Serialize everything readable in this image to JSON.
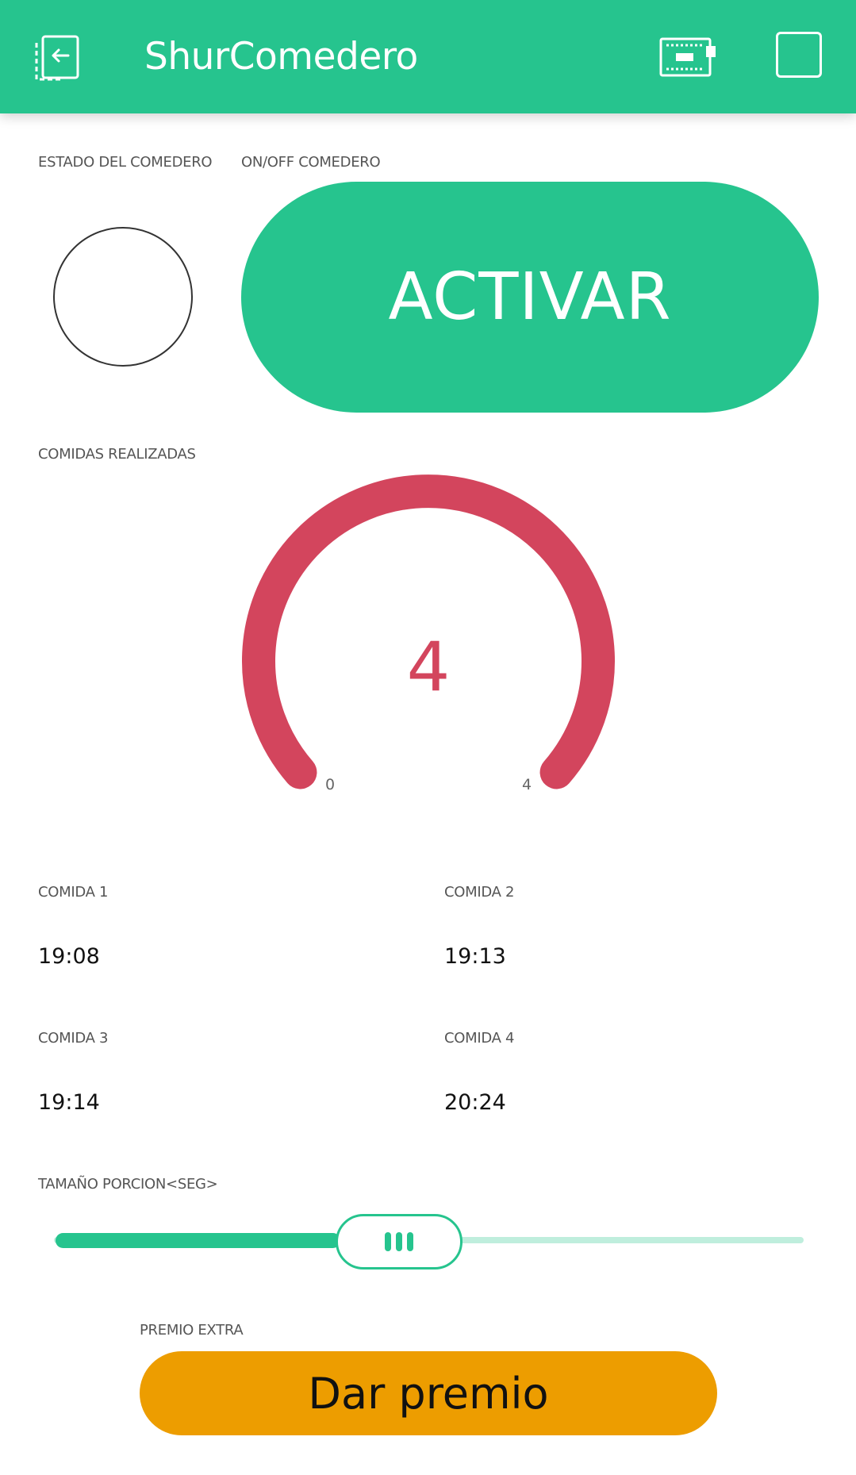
{
  "header": {
    "title": "ShurComedero",
    "background": "#26c48e",
    "icons": [
      "exit-project-icon",
      "device-board-icon",
      "stop-square-icon"
    ]
  },
  "estado": {
    "label": "ESTADO DEL COMEDERO",
    "led_on": false
  },
  "onoff": {
    "label": "ON/OFF COMEDERO",
    "button_label": "ACTIVAR",
    "color": "#26c48e"
  },
  "gauge": {
    "label": "COMIDAS REALIZADAS",
    "value": "4",
    "min": "0",
    "max": "4",
    "color": "#d3455d"
  },
  "comidas": [
    {
      "label": "COMIDA 1",
      "time": "19:08"
    },
    {
      "label": "COMIDA 2",
      "time": "19:13"
    },
    {
      "label": "COMIDA 3",
      "time": "19:14"
    },
    {
      "label": "COMIDA 4",
      "time": "20:24"
    }
  ],
  "porcion": {
    "label": "TAMAÑO PORCION<SEG>",
    "fraction": 0.46
  },
  "premio": {
    "label": "PREMIO EXTRA",
    "button_label": "Dar premio",
    "color": "#ed9d00"
  }
}
